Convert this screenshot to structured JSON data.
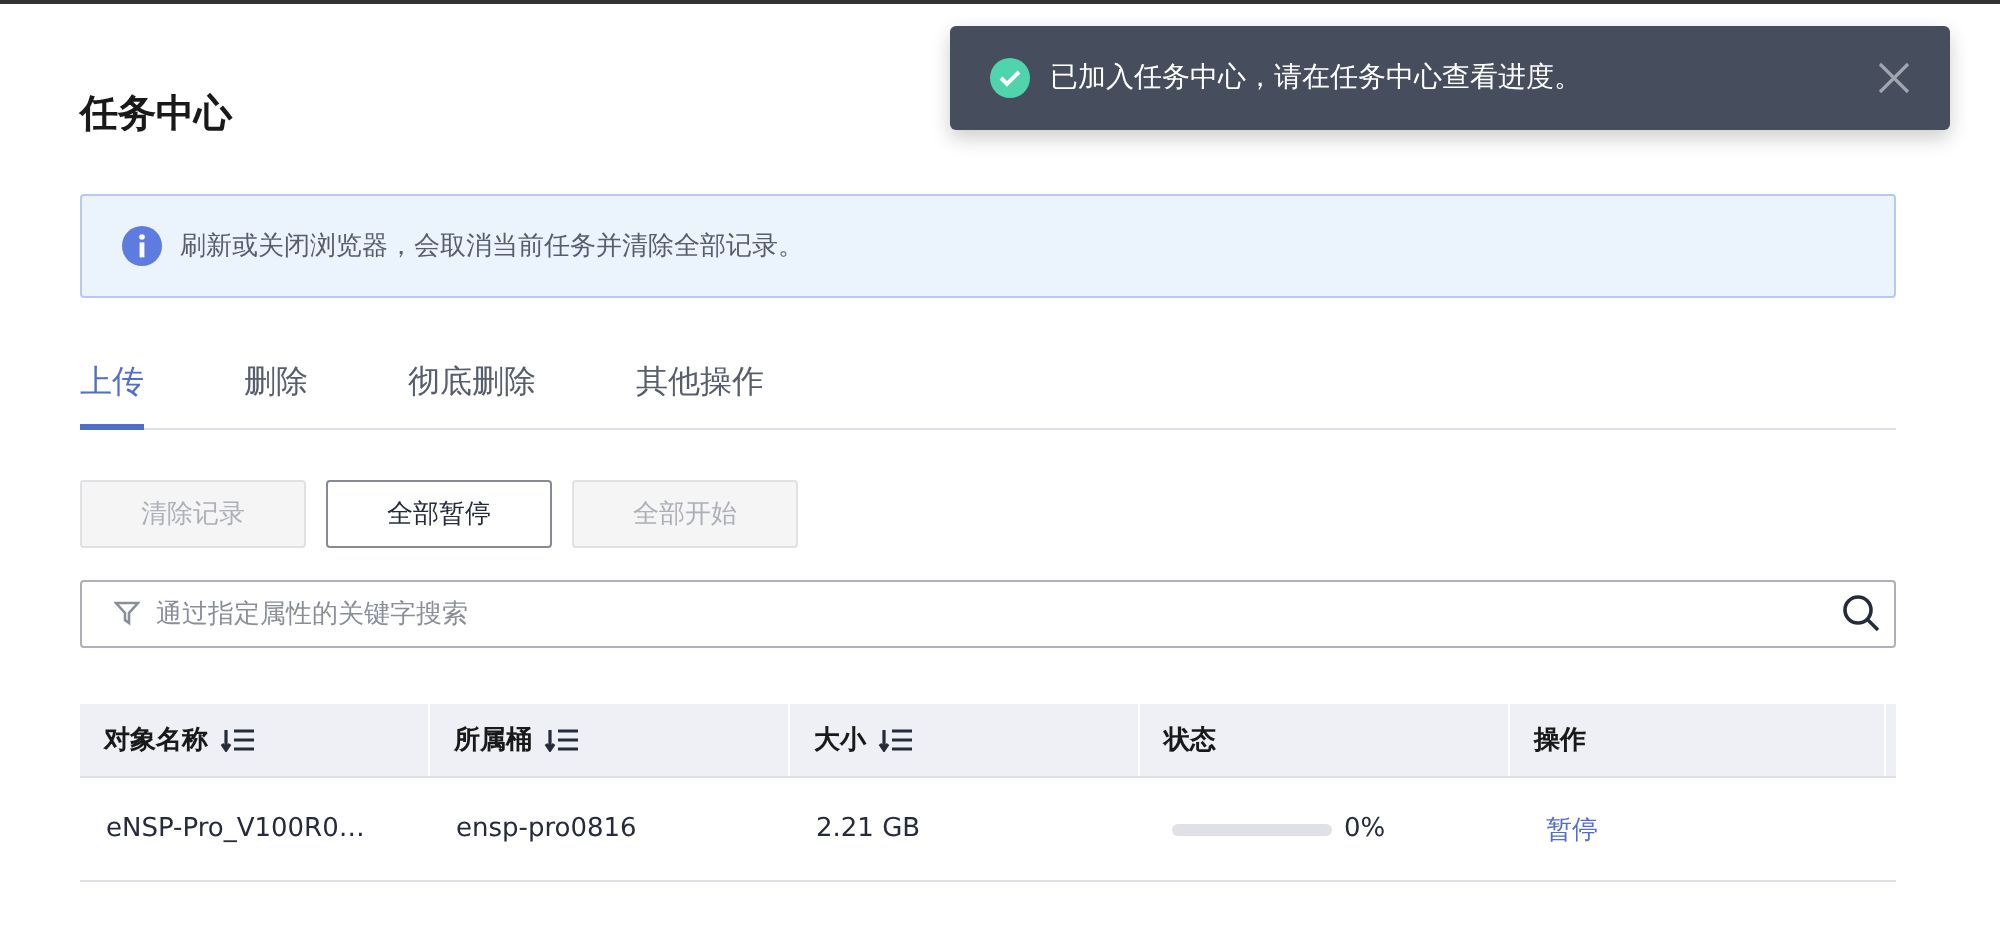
{
  "toast": {
    "message": "已加入任务中心，请在任务中心查看进度。"
  },
  "title": "任务中心",
  "alert": {
    "text": "刷新或关闭浏览器，会取消当前任务并清除全部记录。"
  },
  "tabs": [
    {
      "label": "上传",
      "selected": true
    },
    {
      "label": "删除",
      "selected": false
    },
    {
      "label": "彻底删除",
      "selected": false
    },
    {
      "label": "其他操作",
      "selected": false
    }
  ],
  "buttons": [
    {
      "label": "清除记录",
      "disabled": true
    },
    {
      "label": "全部暂停",
      "disabled": false
    },
    {
      "label": "全部开始",
      "disabled": true
    }
  ],
  "search": {
    "placeholder": "通过指定属性的关键字搜索"
  },
  "table": {
    "columns": [
      {
        "label": "对象名称",
        "sortable": true
      },
      {
        "label": "所属桶",
        "sortable": true
      },
      {
        "label": "大小",
        "sortable": true
      },
      {
        "label": "状态",
        "sortable": false
      },
      {
        "label": "操作",
        "sortable": false
      }
    ],
    "rows": [
      {
        "name": "eNSP-Pro_V100R0…",
        "bucket": "ensp-pro0816",
        "size": "2.21 GB",
        "level": 0,
        "percent": "0%",
        "action": "暂停"
      }
    ]
  }
}
